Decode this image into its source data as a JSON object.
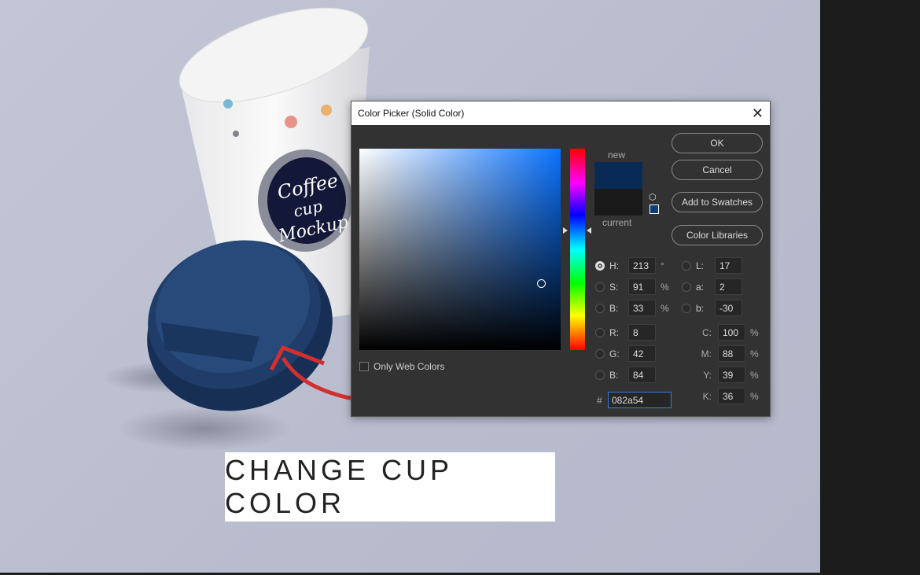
{
  "artwork": {
    "cup_text": [
      "Coffee",
      "cup",
      "Mockup"
    ],
    "lid_color": "#1f3d68",
    "caption": "CHANGE CUP COLOR"
  },
  "dialog": {
    "title": "Color Picker (Solid Color)",
    "only_web_colors": "Only Web Colors",
    "new_label": "new",
    "current_label": "current",
    "new_color": "#082a54",
    "current_color": "#1a1a1a",
    "buttons": {
      "ok": "OK",
      "cancel": "Cancel",
      "add_swatches": "Add to Swatches",
      "libraries": "Color Libraries"
    },
    "fields": {
      "H": {
        "label": "H:",
        "value": "213",
        "unit": "°"
      },
      "S": {
        "label": "S:",
        "value": "91",
        "unit": "%"
      },
      "Bv": {
        "label": "B:",
        "value": "33",
        "unit": "%"
      },
      "R": {
        "label": "R:",
        "value": "8"
      },
      "G": {
        "label": "G:",
        "value": "42"
      },
      "Bl": {
        "label": "B:",
        "value": "84"
      },
      "L": {
        "label": "L:",
        "value": "17"
      },
      "a": {
        "label": "a:",
        "value": "2"
      },
      "b": {
        "label": "b:",
        "value": "-30"
      },
      "C": {
        "label": "C:",
        "value": "100",
        "unit": "%"
      },
      "M": {
        "label": "M:",
        "value": "88",
        "unit": "%"
      },
      "Y": {
        "label": "Y:",
        "value": "39",
        "unit": "%"
      },
      "K": {
        "label": "K:",
        "value": "36",
        "unit": "%"
      }
    },
    "hash": "#",
    "hex": "082a54"
  }
}
